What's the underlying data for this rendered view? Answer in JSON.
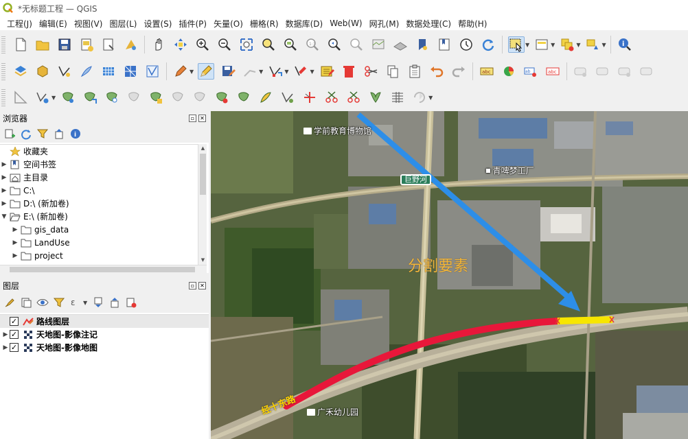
{
  "window": {
    "title": "*无标题工程 — QGIS"
  },
  "menu": [
    "工程(J)",
    "编辑(E)",
    "视图(V)",
    "图层(L)",
    "设置(S)",
    "插件(P)",
    "矢量(O)",
    "栅格(R)",
    "数据库(D)",
    "Web(W)",
    "网孔(M)",
    "数据处理(C)",
    "帮助(H)"
  ],
  "browser_panel": {
    "title": "浏览器",
    "items": [
      {
        "label": "收藏夹",
        "icon": "star-icon",
        "arrow": ""
      },
      {
        "label": "空间书签",
        "icon": "bookmark-icon",
        "arrow": "▶"
      },
      {
        "label": "主目录",
        "icon": "home-folder-icon",
        "arrow": "▶"
      },
      {
        "label": "C:\\",
        "icon": "folder-icon",
        "arrow": "▶"
      },
      {
        "label": "D:\\ (新加卷)",
        "icon": "folder-icon",
        "arrow": "▶"
      },
      {
        "label": "E:\\ (新加卷)",
        "icon": "folder-open-icon",
        "arrow": "▼"
      },
      {
        "label": "gis_data",
        "icon": "folder-icon",
        "arrow": "▶"
      },
      {
        "label": "LandUse",
        "icon": "folder-icon",
        "arrow": "▶"
      },
      {
        "label": "project",
        "icon": "folder-icon",
        "arrow": "▶"
      }
    ]
  },
  "layers_panel": {
    "title": "图层",
    "layers": [
      {
        "label": "路线图层",
        "checked": "✓",
        "icon": "line-layer-icon",
        "arrow": ""
      },
      {
        "label": "天地图-影像注记",
        "checked": "✓",
        "icon": "raster-layer-icon",
        "arrow": "▶"
      },
      {
        "label": "天地图-影像地图",
        "checked": "✓",
        "icon": "raster-layer-icon",
        "arrow": "▶"
      }
    ]
  },
  "map": {
    "annotation": "分割要素",
    "poi_labels": [
      "学前教育博物馆",
      "青啤梦工厂",
      "广禾幼儿园"
    ],
    "road_sign": "巨野河",
    "road_name": "经十东路",
    "colors": {
      "split_part_a": "#e8173a",
      "split_part_b": "#f7e600",
      "arrow": "#2d8ee8"
    }
  }
}
